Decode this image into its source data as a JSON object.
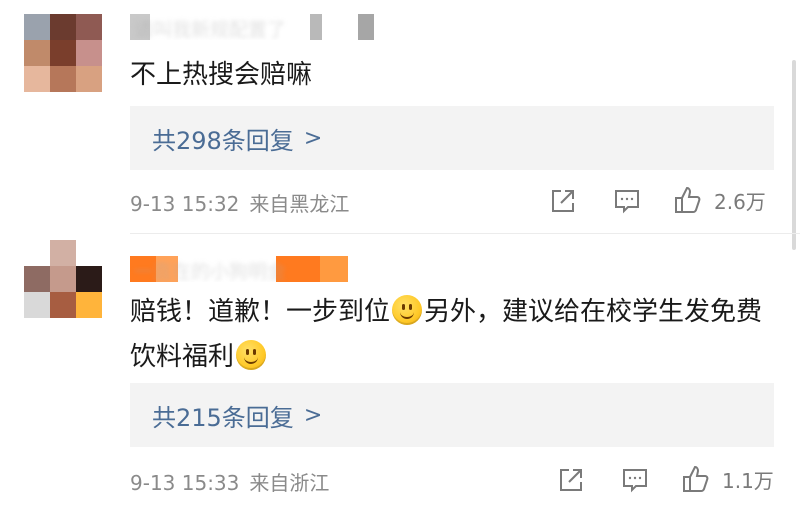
{
  "comments": [
    {
      "username": "请叫我新规配置了",
      "text": "不上热搜会赔嘛",
      "replies_label": "共298条回复",
      "timestamp": "9-13 15:32",
      "location": "来自黑龙江",
      "likes": "2.6万"
    },
    {
      "username": "一直在的小狗明金",
      "text_parts": [
        "赔钱！道歉！一步到位",
        "另外，建议给在校学生发免费饮料福利"
      ],
      "replies_label": "共215条回复",
      "timestamp": "9-13 15:33",
      "location": "来自浙江",
      "likes": "1.1万"
    }
  ],
  "icons": {
    "share": "share-icon",
    "comment": "comment-icon",
    "like": "thumbs-up-icon",
    "emoji": "smile-emoji-icon",
    "reply_chevron": ">"
  },
  "colors": {
    "reply_link": "#4a6c95",
    "meta_text": "#8a8a8a",
    "reply_box": "#f3f3f3",
    "username_blocks": [
      "#ff7a1f",
      "#ff9a40",
      "#b1b1b1"
    ]
  }
}
